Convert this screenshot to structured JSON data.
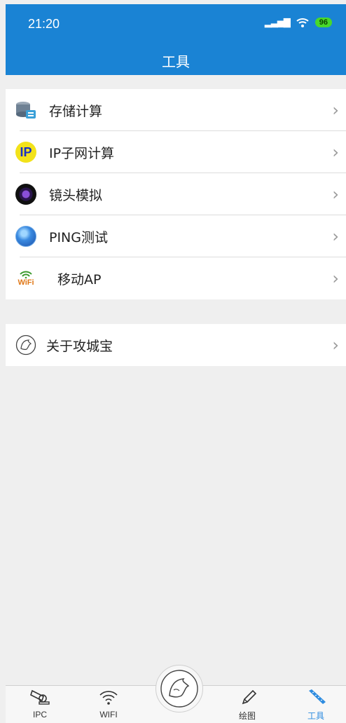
{
  "status": {
    "time": "21:20",
    "battery": "96"
  },
  "header": {
    "title": "工具"
  },
  "tools": [
    {
      "label": "存储计算",
      "icon": "storage-icon"
    },
    {
      "label": "IP子网计算",
      "icon": "ip-icon",
      "badge": "IP"
    },
    {
      "label": "镜头模拟",
      "icon": "lens-icon"
    },
    {
      "label": "PING测试",
      "icon": "globe-icon"
    },
    {
      "label": "移动AP",
      "icon": "wifi-ap-icon",
      "badge": "WiFi"
    }
  ],
  "about": {
    "label": "关于攻城宝",
    "icon": "lion-logo-icon"
  },
  "tabs": [
    {
      "label": "IPC",
      "icon": "camera-icon"
    },
    {
      "label": "WIFI",
      "icon": "wifi-icon"
    },
    {
      "label": "绘图",
      "icon": "pencil-icon"
    },
    {
      "label": "工具",
      "icon": "ruler-icon"
    }
  ],
  "chevron": "›",
  "colors": {
    "primary": "#1a83d4",
    "active_tab": "#2e8ce0",
    "background": "#efefef"
  }
}
